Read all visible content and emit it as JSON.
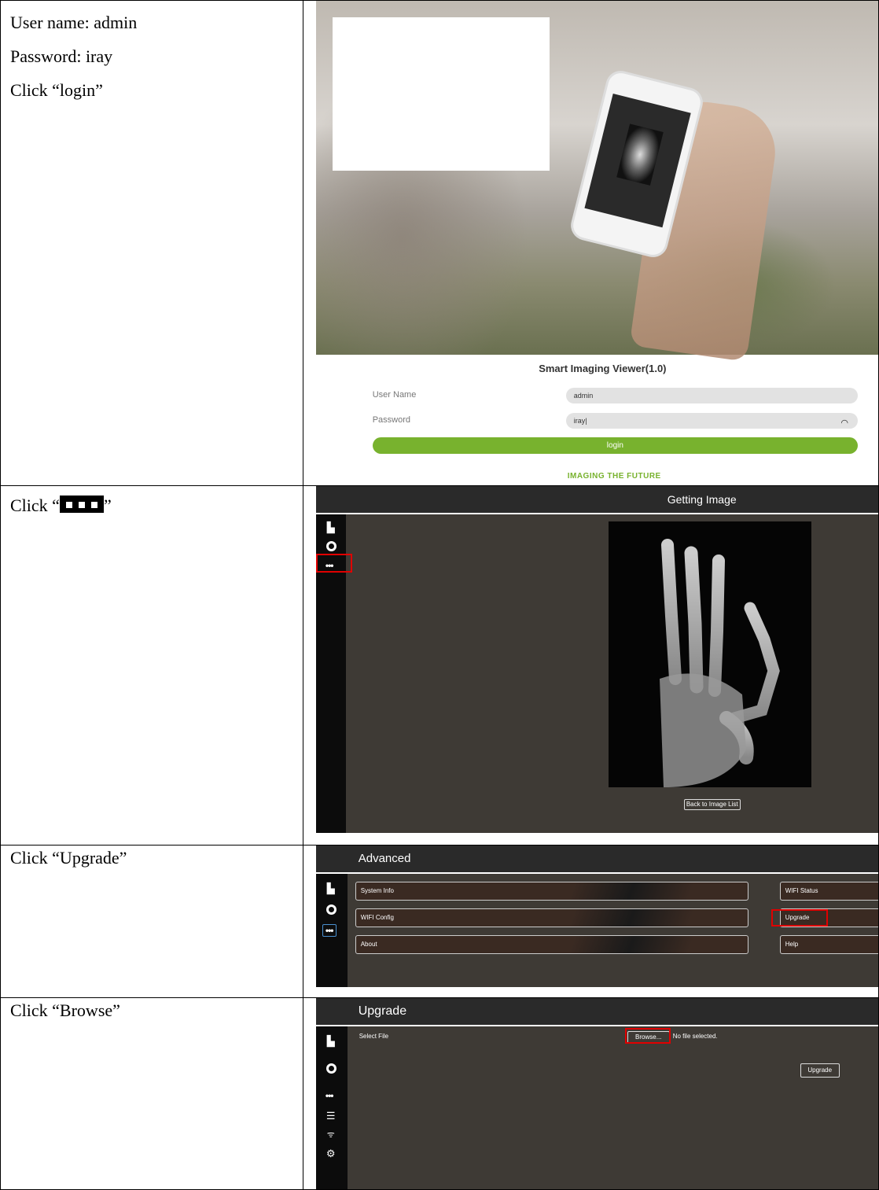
{
  "rows": [
    {
      "instructions": [
        "User name: admin",
        "Password: iray",
        "Click “login”"
      ],
      "screen": {
        "title": "Smart Imaging Viewer(1.0)",
        "username_label": "User Name",
        "username_value": "admin",
        "password_label": "Password",
        "password_value": "iray|",
        "login_label": "login",
        "slogan": "IMAGING THE FUTURE"
      }
    },
    {
      "instruction_prefix": "Click “",
      "instruction_suffix": "”",
      "screen": {
        "title": "Getting Image",
        "back_label": "Back to Image List",
        "more_icon": "more-dots-icon",
        "highlight_color": "#e00000"
      }
    },
    {
      "instruction": "Click “Upgrade”",
      "screen": {
        "title": "Advanced",
        "left_items": [
          "System Info",
          "WIFI Config",
          "About"
        ],
        "right_items": [
          "WIFI Status",
          "Upgrade",
          "Help"
        ]
      }
    },
    {
      "instruction": "Click “Browse”",
      "screen": {
        "title": "Upgrade",
        "select_label": "Select File",
        "browse_label": "Browse...",
        "no_file": "No file selected.",
        "upgrade_label": "Upgrade"
      }
    }
  ],
  "colors": {
    "accent_green": "#78b22e",
    "dark_panel": "#3e3a35",
    "highlight_red": "#e00000"
  }
}
